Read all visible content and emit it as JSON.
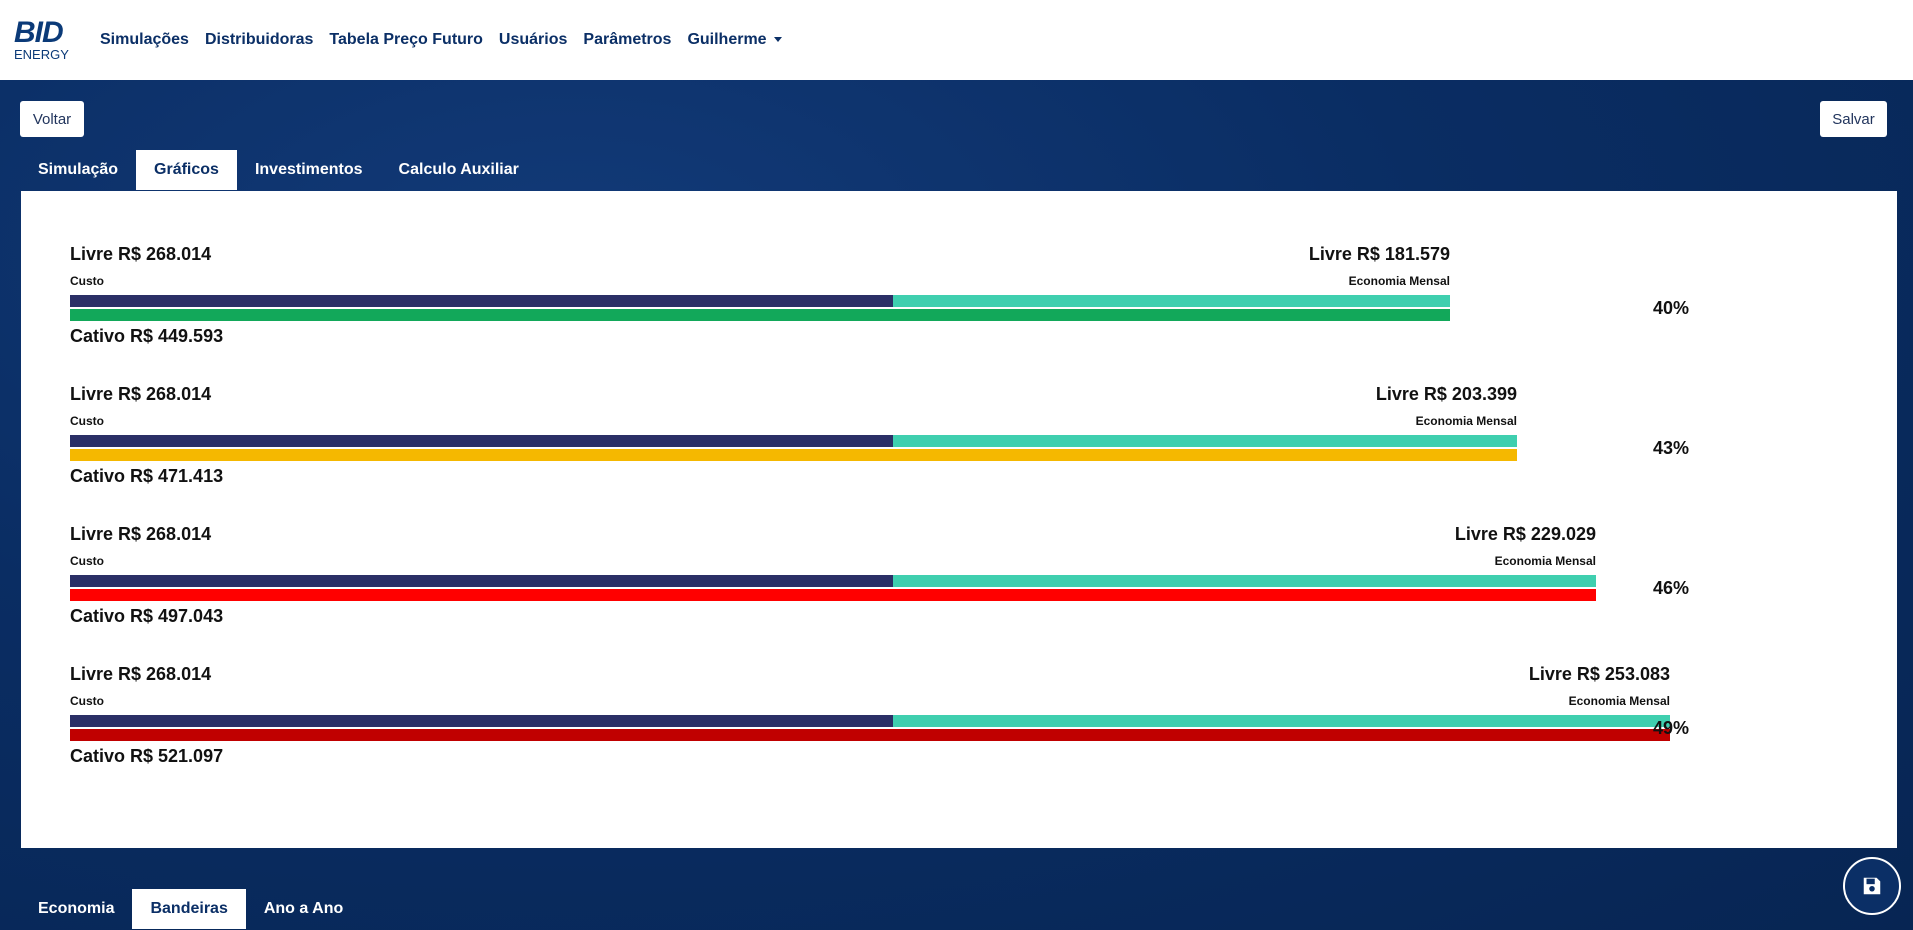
{
  "brand": {
    "logo_top": "BID",
    "logo_bottom": "ENERGY"
  },
  "nav": {
    "items": [
      "Simulações",
      "Distribuidoras",
      "Tabela Preço Futuro",
      "Usuários",
      "Parâmetros"
    ],
    "user": "Guilherme"
  },
  "actions": {
    "back": "Voltar",
    "save": "Salvar"
  },
  "top_tabs": [
    {
      "label": "Simulação",
      "active": false
    },
    {
      "label": "Gráficos",
      "active": true
    },
    {
      "label": "Investimentos",
      "active": false
    },
    {
      "label": "Calculo Auxiliar",
      "active": false
    }
  ],
  "chart_data": {
    "type": "bar",
    "custo_label": "Custo",
    "economia_label": "Economia Mensal",
    "rows": [
      {
        "livre_custo": "Livre R$ 268.014",
        "livre_economia": "Livre R$ 181.579",
        "cativo": "Cativo R$ 449.593",
        "pct": "40%",
        "custo": 268014,
        "economia": 181579,
        "total": 449593,
        "cativo_color": "#12a85a"
      },
      {
        "livre_custo": "Livre R$ 268.014",
        "livre_economia": "Livre R$ 203.399",
        "cativo": "Cativo R$ 471.413",
        "pct": "43%",
        "custo": 268014,
        "economia": 203399,
        "total": 471413,
        "cativo_color": "#f5b800"
      },
      {
        "livre_custo": "Livre R$ 268.014",
        "livre_economia": "Livre R$ 229.029",
        "cativo": "Cativo R$ 497.043",
        "pct": "46%",
        "custo": 268014,
        "economia": 229029,
        "total": 497043,
        "cativo_color": "#ff0000"
      },
      {
        "livre_custo": "Livre R$ 268.014",
        "livre_economia": "Livre R$ 253.083",
        "cativo": "Cativo R$ 521.097",
        "pct": "49%",
        "custo": 268014,
        "economia": 253083,
        "total": 521097,
        "cativo_color": "#c00000"
      }
    ]
  },
  "bottom_tabs": [
    {
      "label": "Economia",
      "active": false
    },
    {
      "label": "Bandeiras",
      "active": true
    },
    {
      "label": "Ano a Ano",
      "active": false
    }
  ],
  "icons": {
    "save_fab": "floppy-disk-icon",
    "user_menu": "chevron-down-icon"
  },
  "colors": {
    "navy": "#0a2d63",
    "custo_bar": "#2b2f66",
    "economia_bar": "#3fcfaf"
  }
}
